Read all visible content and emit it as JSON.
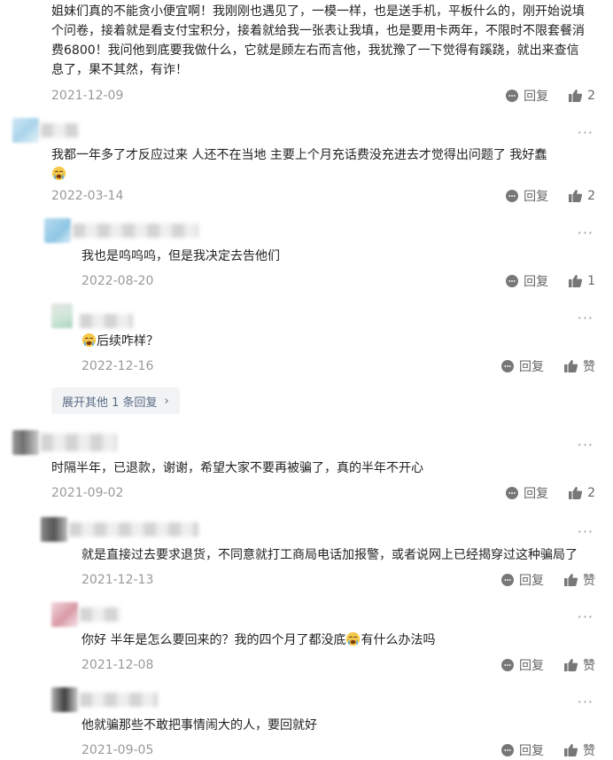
{
  "comments": [
    {
      "id": "c0",
      "content": "姐妹们真的不能贪小便宜啊！我刚刚也遇见了，一模一样，也是送手机，平板什么的，刚开始说填个问卷，接着就是看支付宝积分，接着就给我一张表让我填，也是要用卡两年，不限时不限套餐消费6800！我问他到底要我做什么，它就是顾左右而言他，我犹豫了一下觉得有蹊跷，就出来查信息了，果不其然，有诈！",
      "date": "2021-12-09",
      "reply_label": "回复",
      "like_label": "2"
    },
    {
      "id": "c1",
      "content": "我都一年多了才反应过来 人还不在当地 主要上个月充话费没充进去才觉得出问题了 我好蠢",
      "date": "2022-03-14",
      "reply_label": "回复",
      "like_label": "2"
    },
    {
      "id": "c2",
      "content": "我也是呜呜呜，但是我决定去告他们",
      "date": "2022-08-20",
      "reply_label": "回复",
      "like_label": "1"
    },
    {
      "id": "c3",
      "content": "后续咋样？",
      "date": "2022-12-16",
      "reply_label": "回复",
      "like_label": "赞"
    },
    {
      "id": "c4",
      "content": "时隔半年，已退款，谢谢，希望大家不要再被骗了，真的半年不开心",
      "date": "2021-09-02",
      "reply_label": "回复",
      "like_label": "2"
    },
    {
      "id": "c5",
      "content": "就是直接过去要求退货，不同意就打工商局电话加报警，或者说网上已经揭穿过这种骗局了",
      "date": "2021-12-13",
      "reply_label": "回复",
      "like_label": "赞"
    },
    {
      "id": "c6",
      "content_before": "你好 半年是怎么要回来的？我的四个月了都没底",
      "content_after": "有什么办法吗",
      "date": "2021-12-08",
      "reply_label": "回复",
      "like_label": "赞"
    },
    {
      "id": "c7",
      "content": "他就骗那些不敢把事情闹大的人，要回就好",
      "date": "2021-09-05",
      "reply_label": "回复",
      "like_label": "赞"
    }
  ],
  "expand": {
    "label": "展开其他 1 条回复",
    "chevron": "›"
  },
  "more_label": "···",
  "icons": {
    "reply": "reply-bubble-icon",
    "like": "thumbs-up-icon",
    "emoji": "crying-face-emoji"
  },
  "colors": {
    "text": "#222222",
    "meta": "#999999",
    "action": "#666666",
    "expand_bg": "#f2f3f5",
    "expand_text": "#5a6b86"
  }
}
